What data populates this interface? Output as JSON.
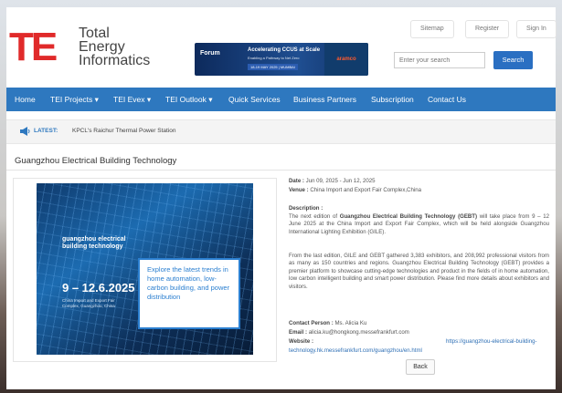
{
  "header": {
    "logo_mark": "TE",
    "logo_lines": [
      "Total",
      "Energy",
      "Informatics"
    ],
    "links": [
      "Sitemap",
      "Register",
      "Sign In"
    ],
    "search": {
      "placeholder": "Enter your search",
      "button": "Search"
    },
    "banner": {
      "forum": "Forum",
      "title": "Accelerating CCUS at Scale",
      "sub": "Enabling a Pathway to Net Zero",
      "date": "18-19 MAY 2025 | MUMBAI",
      "sponsor": "aramco"
    }
  },
  "nav": {
    "items": [
      "Home",
      "TEI Projects",
      "TEI Evex",
      "TEI Outlook",
      "Quick Services",
      "Business Partners",
      "Subscription",
      "Contact Us"
    ]
  },
  "latest": {
    "label": "LATEST:",
    "text": "KPCL's Raichur Thermal Power Station"
  },
  "page": {
    "title": "Guangzhou Electrical Building Technology"
  },
  "poster": {
    "brand_line1": "guangzhou electrical",
    "brand_line2": "building technology",
    "dates": "9 – 12.6.2025",
    "place": "China Import and Export Fair Complex, Guangzhou, China",
    "promo": "Explore the latest trends in home automation, low-carbon building, and power distribution"
  },
  "details": {
    "date_label": "Date :",
    "date_value": "Jun 09, 2025 - Jun 12, 2025",
    "venue_label": "Venue :",
    "venue_value": "China Import and Export Fair Complex,China",
    "description_label": "Description :",
    "desc1_prefix": "The next edition of ",
    "desc1_bold": "Guangzhou Electrical Building Technology (GEBT)",
    "desc1_suffix": " will take place from 9 – 12 June 2025 at the China Import and Export Fair Complex, which will be held alongside Guangzhou International Lighting Exhibition (GILE).",
    "desc2": "From the last edition, GILE and GEBT gathered 3,383 exhibitors, and 208,992 professional visitors from as many as 150 countries and regions. Guangzhou Electrical Building Technology (GEBT) provides a premier platform to showcase cutting-edge technologies and product in the fields of in home automation, low carbon intelligent building and smart power distribution. Please find more details about exhibitors and visitors.",
    "contact_label": "Contact Person :",
    "contact_value": "Ms. Alicia Ku",
    "email_label": "Email :",
    "email_value": "alicia.ku@hongkong.messefrankfurt.com",
    "website_label": "Website :",
    "website_part1": "https://guangzhou-electrical-building-",
    "website_part2": "technology.hk.messefrankfurt.com/guangzhou/en.html",
    "back": "Back"
  }
}
